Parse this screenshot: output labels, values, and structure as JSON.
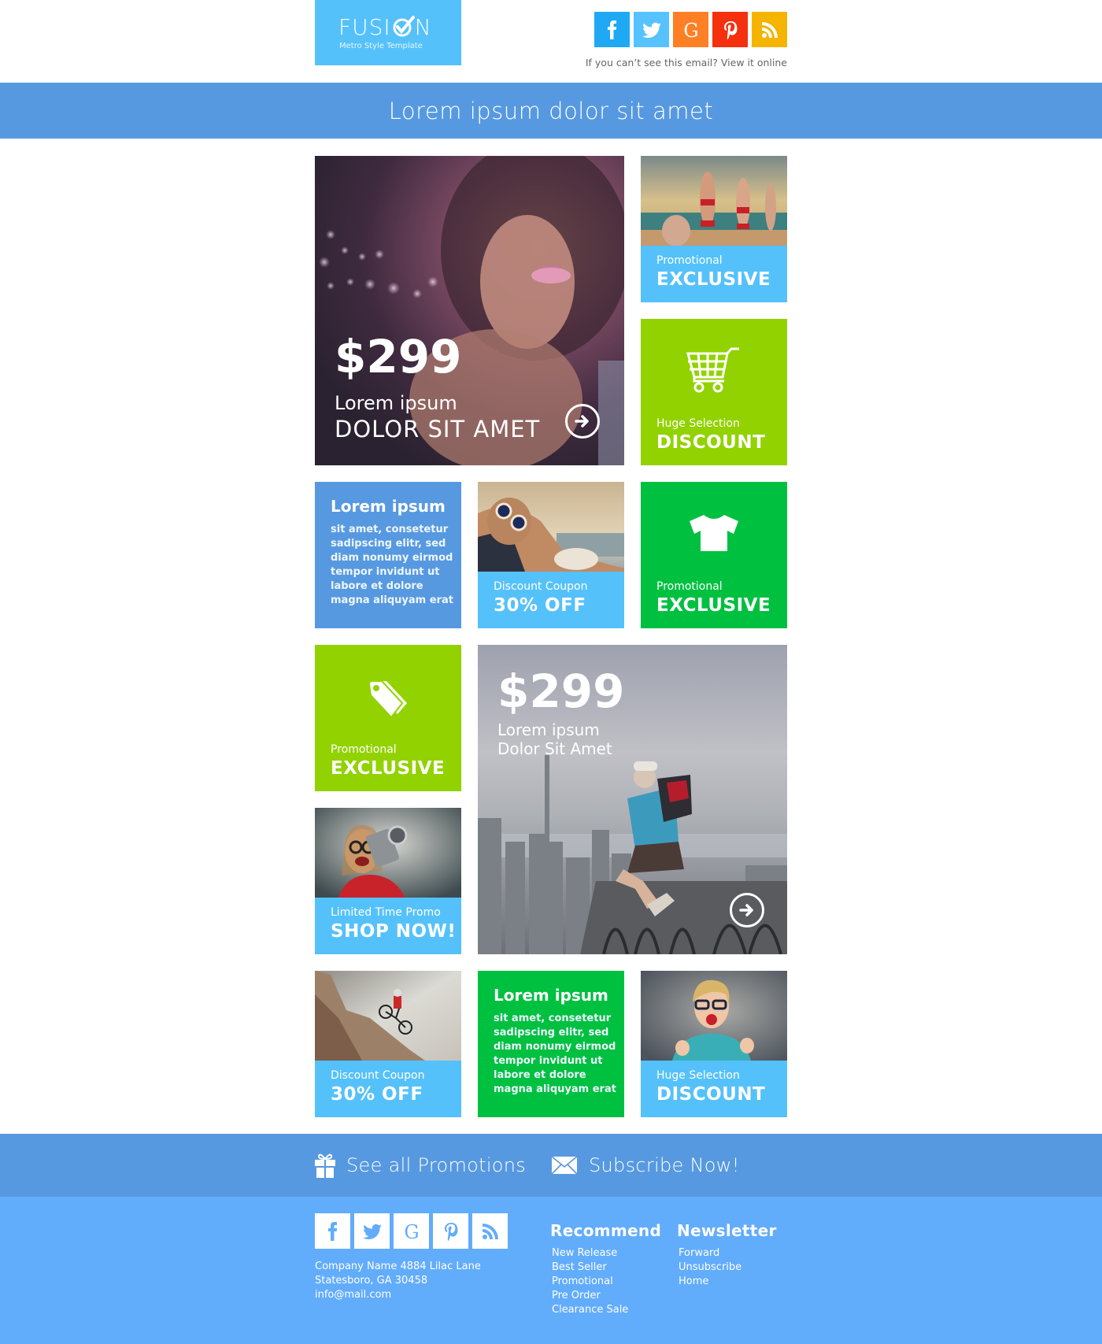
{
  "header": {
    "logo_word": "FUSION",
    "logo_tagline": "Metro Style Template",
    "social": [
      {
        "name": "facebook",
        "icon": "facebook-icon",
        "color": "#1fa9f5"
      },
      {
        "name": "twitter",
        "icon": "twitter-icon",
        "color": "#56c2ff"
      },
      {
        "name": "google",
        "icon": "google-icon",
        "color": "#ff7f24"
      },
      {
        "name": "pinterest",
        "icon": "pinterest-icon",
        "color": "#f5300f"
      },
      {
        "name": "rss",
        "icon": "rss-icon",
        "color": "#f4b400"
      }
    ],
    "view_online": "If you can’t see this email? View it online"
  },
  "banner": {
    "title": "Lorem ipsum dolor sit amet"
  },
  "colors": {
    "blue_dark": "#5799e0",
    "blue_light": "#55c1fb",
    "lime": "#92d200",
    "green": "#00c040",
    "footer": "#62acfc"
  },
  "tiles": {
    "hero1": {
      "price": "$299",
      "line1": "Lorem ipsum",
      "line2": "DOLOR SIT AMET",
      "icon": "arrow-right-circle-icon"
    },
    "beach_group": {
      "small": "Promotional",
      "big": "EXCLUSIVE"
    },
    "cart": {
      "small": "Huge Selection",
      "big": "DISCOUNT",
      "icon": "shopping-cart-icon"
    },
    "text1": {
      "title": "Lorem ipsum",
      "body": "sit amet, consetetur sadipscing elitr, sed diam nonumy eirmod tempor invidunt ut labore et dolore magna aliquyam erat"
    },
    "sunbather": {
      "small": "Discount Coupon",
      "big": "30% OFF"
    },
    "shirt": {
      "small": "Promotional",
      "big": "EXCLUSIVE",
      "icon": "t-shirt-icon"
    },
    "tag": {
      "small": "Promotional",
      "big": "EXCLUSIVE",
      "icon": "price-tag-icon"
    },
    "camera": {
      "small": "Limited Time Promo",
      "big": "SHOP NOW!"
    },
    "hero2": {
      "price": "$299",
      "line1": "Lorem ipsum",
      "line2": "Dolor Sit Amet",
      "icon": "arrow-right-circle-icon"
    },
    "biker": {
      "small": "Discount Coupon",
      "big": "30% OFF"
    },
    "text2": {
      "title": "Lorem ipsum",
      "body": "sit amet, consetetur sadipscing elitr, sed diam nonumy eirmod tempor invidunt ut labore et dolore magna aliquyam erat"
    },
    "excited": {
      "small": "Huge Selection",
      "big": "DISCOUNT"
    }
  },
  "cta": {
    "promotions": {
      "label": "See all Promotions",
      "icon": "gift-icon"
    },
    "subscribe": {
      "label": "Subscribe Now!",
      "icon": "envelope-icon"
    }
  },
  "footer": {
    "address": [
      "Company Name 4884 Lilac Lane",
      "Statesboro, GA 30458",
      "info@mail.com"
    ],
    "recommend": {
      "title": "Recommend",
      "links": [
        "New Release",
        "Best Seller",
        "Promotional",
        "Pre Order",
        "Clearance Sale"
      ]
    },
    "newsletter": {
      "title": "Newsletter",
      "links": [
        "Forward",
        "Unsubscribe",
        "Home"
      ]
    }
  }
}
